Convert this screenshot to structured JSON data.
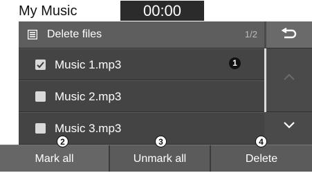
{
  "statusbar": {
    "app_title": "My Music",
    "clock": "00:00"
  },
  "header": {
    "title": "Delete files",
    "page_indicator": "1/2"
  },
  "list": {
    "items": [
      {
        "label": "Music 1.mp3",
        "checked": true
      },
      {
        "label": "Music 2.mp3",
        "checked": false
      },
      {
        "label": "Music 3.mp3",
        "checked": false
      }
    ]
  },
  "bottombar": {
    "mark_all": "Mark all",
    "unmark_all": "Unmark all",
    "delete": "Delete"
  },
  "callouts": [
    "1",
    "2",
    "3",
    "4"
  ],
  "icons": {
    "header": "list-doc-icon",
    "back": "back-arrow-icon",
    "scroll_up": "chevron-up-icon",
    "scroll_down": "chevron-down-icon",
    "check": "checkmark-icon"
  },
  "colors": {
    "screen_bg": "#4a4a4a",
    "header_bg": "#5e5e5e",
    "text": "#ffffff",
    "clock_bg": "#2b2b2b"
  }
}
